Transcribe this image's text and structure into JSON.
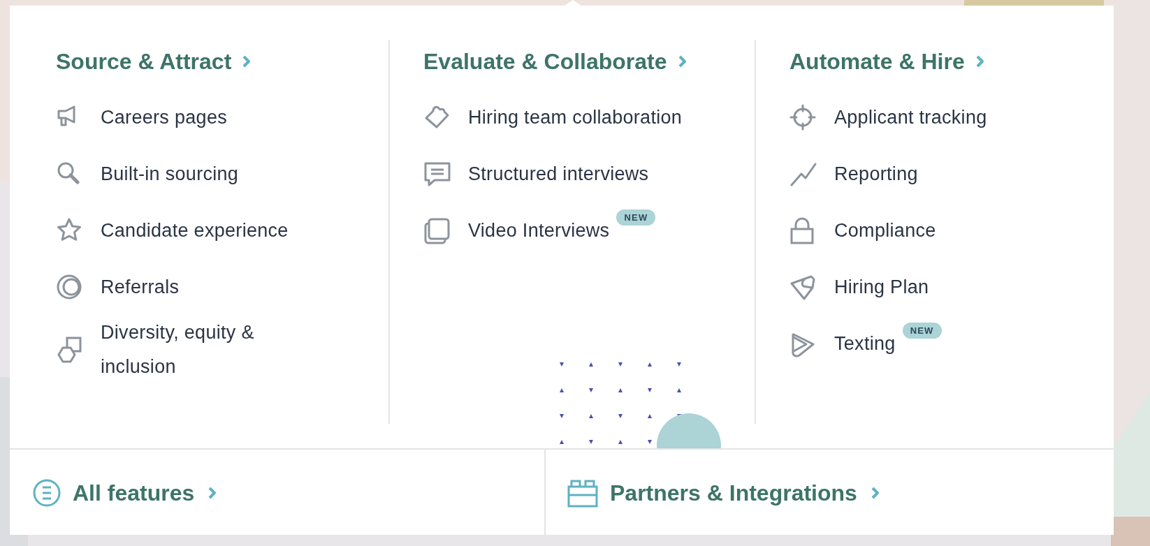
{
  "columns": [
    {
      "title": "Source & Attract",
      "items": [
        {
          "label": "Careers pages"
        },
        {
          "label": "Built-in sourcing"
        },
        {
          "label": "Candidate experience"
        },
        {
          "label": "Referrals"
        },
        {
          "label": "Diversity, equity & inclusion"
        }
      ]
    },
    {
      "title": "Evaluate & Collaborate",
      "items": [
        {
          "label": "Hiring team collaboration"
        },
        {
          "label": "Structured interviews"
        },
        {
          "label": "Video Interviews",
          "badge": "NEW"
        }
      ]
    },
    {
      "title": "Automate & Hire",
      "items": [
        {
          "label": "Applicant tracking"
        },
        {
          "label": "Reporting"
        },
        {
          "label": "Compliance"
        },
        {
          "label": "Hiring Plan"
        },
        {
          "label": "Texting",
          "badge": "NEW"
        }
      ]
    }
  ],
  "footer_links": [
    {
      "label": "All features"
    },
    {
      "label": "Partners & Integrations"
    }
  ]
}
